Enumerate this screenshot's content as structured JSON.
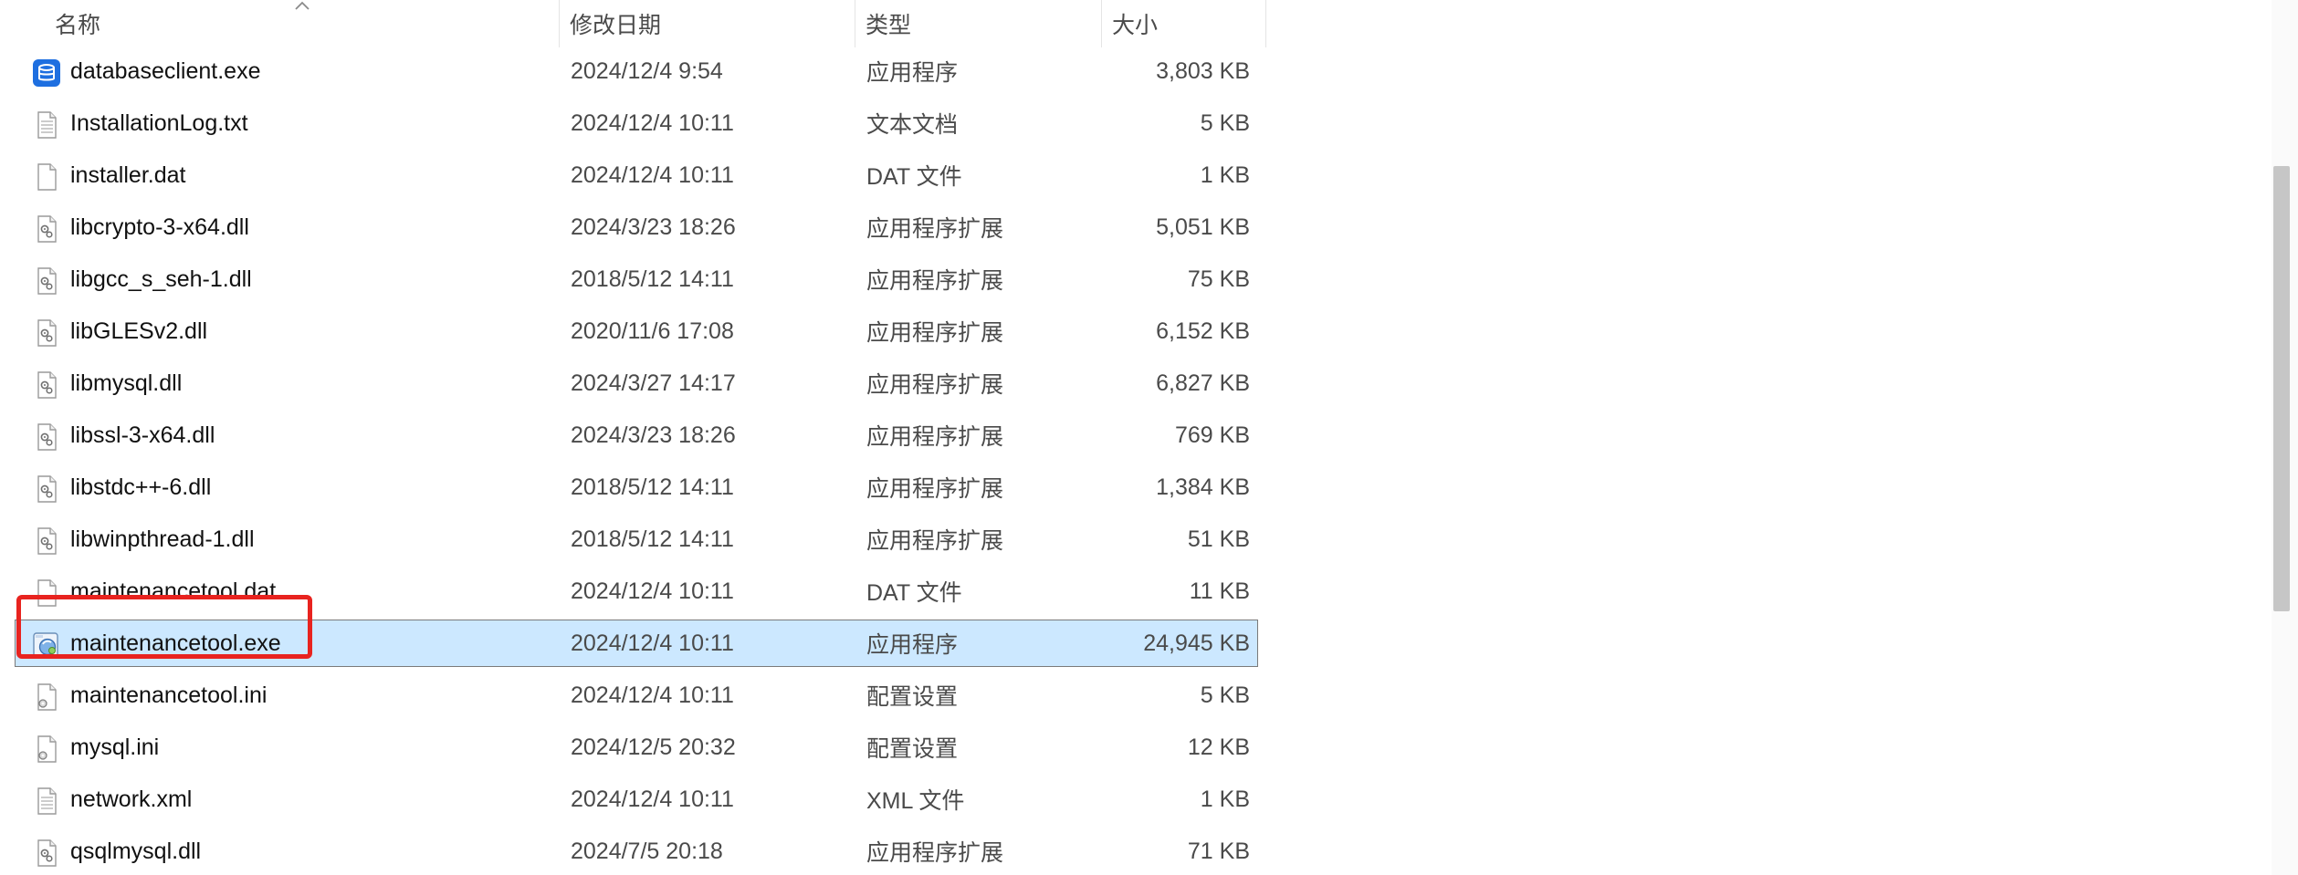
{
  "header": {
    "name": "名称",
    "modified": "修改日期",
    "type": "类型",
    "size": "大小"
  },
  "colors": {
    "selection_bg": "#cce8ff",
    "highlight": "#e8231f",
    "exe_blue": "#1e6fe0"
  },
  "files": [
    {
      "name": "databaseclient.exe",
      "modified": "2024/12/4 9:54",
      "type": "应用程序",
      "size": "3,803 KB",
      "icon": "database-exe-icon"
    },
    {
      "name": "InstallationLog.txt",
      "modified": "2024/12/4 10:11",
      "type": "文本文档",
      "size": "5 KB",
      "icon": "text-file-icon"
    },
    {
      "name": "installer.dat",
      "modified": "2024/12/4 10:11",
      "type": "DAT 文件",
      "size": "1 KB",
      "icon": "blank-file-icon"
    },
    {
      "name": "libcrypto-3-x64.dll",
      "modified": "2024/3/23 18:26",
      "type": "应用程序扩展",
      "size": "5,051 KB",
      "icon": "dll-file-icon"
    },
    {
      "name": "libgcc_s_seh-1.dll",
      "modified": "2018/5/12 14:11",
      "type": "应用程序扩展",
      "size": "75 KB",
      "icon": "dll-file-icon"
    },
    {
      "name": "libGLESv2.dll",
      "modified": "2020/11/6 17:08",
      "type": "应用程序扩展",
      "size": "6,152 KB",
      "icon": "dll-file-icon"
    },
    {
      "name": "libmysql.dll",
      "modified": "2024/3/27 14:17",
      "type": "应用程序扩展",
      "size": "6,827 KB",
      "icon": "dll-file-icon"
    },
    {
      "name": "libssl-3-x64.dll",
      "modified": "2024/3/23 18:26",
      "type": "应用程序扩展",
      "size": "769 KB",
      "icon": "dll-file-icon"
    },
    {
      "name": "libstdc++-6.dll",
      "modified": "2018/5/12 14:11",
      "type": "应用程序扩展",
      "size": "1,384 KB",
      "icon": "dll-file-icon"
    },
    {
      "name": "libwinpthread-1.dll",
      "modified": "2018/5/12 14:11",
      "type": "应用程序扩展",
      "size": "51 KB",
      "icon": "dll-file-icon"
    },
    {
      "name": "maintenancetool.dat",
      "modified": "2024/12/4 10:11",
      "type": "DAT 文件",
      "size": "11 KB",
      "icon": "blank-file-icon"
    },
    {
      "name": "maintenancetool.exe",
      "modified": "2024/12/4 10:11",
      "type": "应用程序",
      "size": "24,945 KB",
      "icon": "installer-exe-icon",
      "selected": true
    },
    {
      "name": "maintenancetool.ini",
      "modified": "2024/12/4 10:11",
      "type": "配置设置",
      "size": "5 KB",
      "icon": "ini-file-icon"
    },
    {
      "name": "mysql.ini",
      "modified": "2024/12/5 20:32",
      "type": "配置设置",
      "size": "12 KB",
      "icon": "ini-file-icon"
    },
    {
      "name": "network.xml",
      "modified": "2024/12/4 10:11",
      "type": "XML 文件",
      "size": "1 KB",
      "icon": "text-file-icon"
    },
    {
      "name": "qsqlmysql.dll",
      "modified": "2024/7/5 20:18",
      "type": "应用程序扩展",
      "size": "71 KB",
      "icon": "dll-file-icon"
    }
  ]
}
